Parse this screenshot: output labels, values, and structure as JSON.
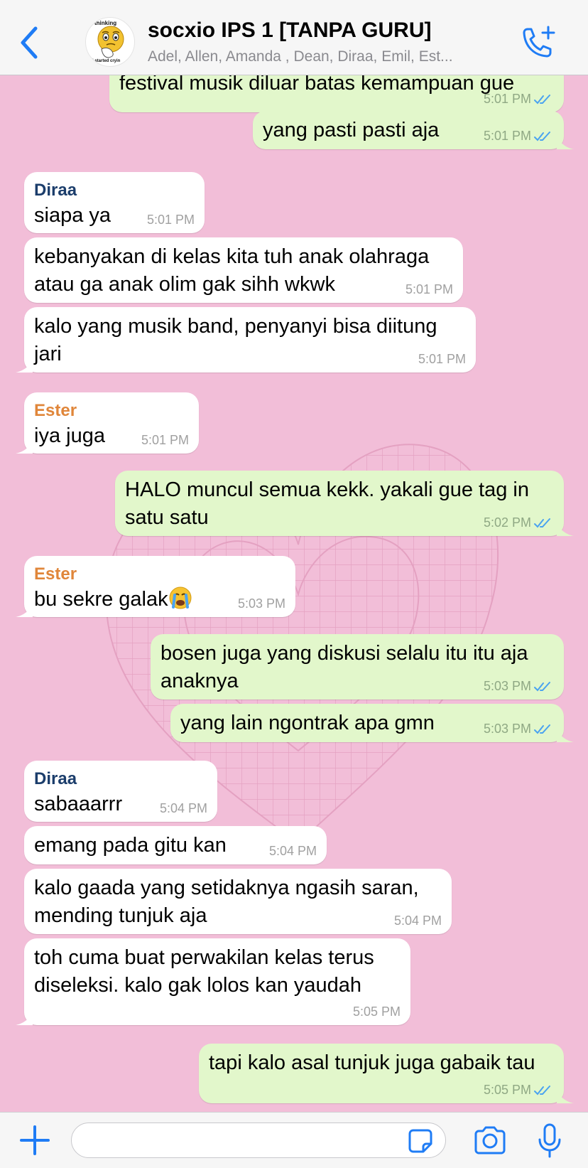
{
  "header": {
    "title": "socxio IPS 1 [TANPA GURU]",
    "subtitle": "Adel, Allen, Amanda , Dean, Diraa, Emil, Est...",
    "avatar_caption_top": "thinking",
    "avatar_caption_bottom": "I started cryin",
    "back_icon": "chevron-left-icon",
    "call_icon": "phone-plus-icon"
  },
  "colors": {
    "accent": "#1f7cf5",
    "background": "#f2bed8",
    "incoming_bubble": "#ffffff",
    "outgoing_bubble": "#e2f7cb",
    "sender_diraa": "#1b3d6b",
    "sender_ester": "#e0863a",
    "read_ticks": "#4aa3f0"
  },
  "messages": [
    {
      "dir": "out",
      "text": "festival musik diluar batas kemampuan gue",
      "time": "5:01 PM",
      "ticks": true
    },
    {
      "dir": "out",
      "text": "yang pasti pasti aja",
      "time": "5:01 PM",
      "ticks": true
    },
    {
      "dir": "in",
      "sender": "Diraa",
      "text": "siapa ya",
      "time": "5:01 PM"
    },
    {
      "dir": "in",
      "text": "kebanyakan di kelas kita tuh anak olahraga atau ga anak olim gak sihh wkwk",
      "time": "5:01 PM"
    },
    {
      "dir": "in",
      "text": "kalo yang musik band, penyanyi bisa diitung jari",
      "time": "5:01 PM"
    },
    {
      "dir": "in",
      "sender": "Ester",
      "text": "iya juga",
      "time": "5:01 PM"
    },
    {
      "dir": "out",
      "text": "HALO muncul semua kekk. yakali gue tag in satu satu",
      "time": "5:02 PM",
      "ticks": true
    },
    {
      "dir": "in",
      "sender": "Ester",
      "text": "bu sekre galak",
      "emoji": "crying-face",
      "time": "5:03 PM"
    },
    {
      "dir": "out",
      "text": "bosen juga yang diskusi selalu itu itu aja anaknya",
      "time": "5:03 PM",
      "ticks": true
    },
    {
      "dir": "out",
      "text": "yang lain ngontrak apa gmn",
      "time": "5:03 PM",
      "ticks": true
    },
    {
      "dir": "in",
      "sender": "Diraa",
      "text": "sabaaarrr",
      "time": "5:04 PM"
    },
    {
      "dir": "in",
      "text": "emang pada gitu kan",
      "time": "5:04 PM"
    },
    {
      "dir": "in",
      "text": "kalo gaada yang setidaknya ngasih saran, mending tunjuk aja",
      "time": "5:04 PM"
    },
    {
      "dir": "in",
      "text": "toh cuma buat perwakilan kelas terus diseleksi. kalo gak lolos kan yaudah",
      "time": "5:05 PM"
    },
    {
      "dir": "out",
      "text": "tapi kalo asal tunjuk juga gabaik tau",
      "time": "5:05 PM",
      "ticks": true
    }
  ],
  "input": {
    "placeholder": "",
    "value": "",
    "icons": [
      "plus-icon",
      "sticker-icon",
      "camera-icon",
      "microphone-icon"
    ]
  }
}
